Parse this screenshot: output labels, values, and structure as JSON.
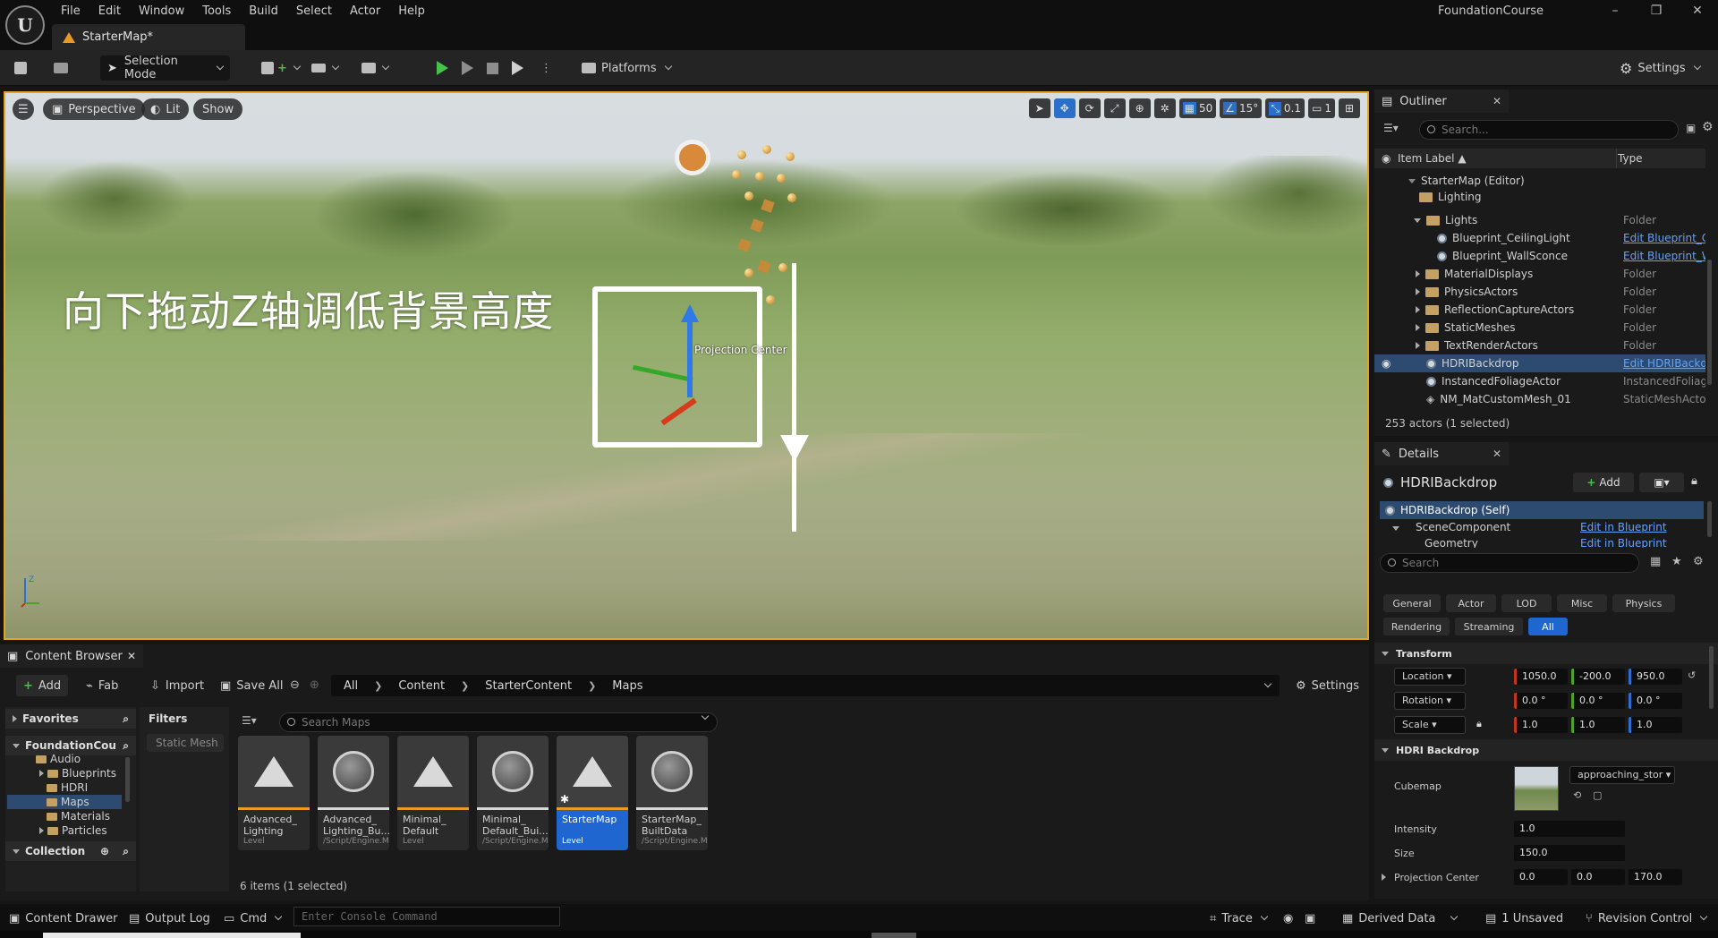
{
  "app": {
    "project_name": "FoundationCourse",
    "map_tab": "StarterMap*",
    "menus": [
      "File",
      "Edit",
      "Window",
      "Tools",
      "Build",
      "Select",
      "Actor",
      "Help"
    ]
  },
  "toolbar": {
    "selection_mode": "Selection Mode",
    "platforms": "Platforms",
    "settings": "Settings"
  },
  "viewport": {
    "perspective": "Perspective",
    "lit": "Lit",
    "show": "Show",
    "grid_snap": "50",
    "rot_snap": "15°",
    "scale_snap": "0.1",
    "camera_speed": "1",
    "annotation": "向下拖动Z轴调低背景高度",
    "actor_label": "Projection Center"
  },
  "outliner": {
    "title": "Outliner",
    "search_placeholder": "Search...",
    "col_label": "Item Label ▲",
    "col_type": "Type",
    "rows": [
      {
        "label": "StarterMap (Editor)",
        "type": ""
      },
      {
        "label": "Lighting",
        "type": ""
      },
      {
        "label": "Lights",
        "type": "Folder"
      },
      {
        "label": "Blueprint_CeilingLight",
        "type": "Edit Blueprint_C"
      },
      {
        "label": "Blueprint_WallSconce",
        "type": "Edit Blueprint_W"
      },
      {
        "label": "MaterialDisplays",
        "type": "Folder"
      },
      {
        "label": "PhysicsActors",
        "type": "Folder"
      },
      {
        "label": "ReflectionCaptureActors",
        "type": "Folder"
      },
      {
        "label": "StaticMeshes",
        "type": "Folder"
      },
      {
        "label": "TextRenderActors",
        "type": "Folder"
      },
      {
        "label": "HDRIBackdrop",
        "type": "Edit HDRIBackdr"
      },
      {
        "label": "InstancedFoliageActor",
        "type": "InstancedFoliag"
      },
      {
        "label": "NM_MatCustomMesh_01",
        "type": "StaticMeshActo"
      }
    ],
    "status": "253 actors (1 selected)"
  },
  "details": {
    "title": "Details",
    "actor_name": "HDRIBackdrop",
    "add": "Add",
    "self": "HDRIBackdrop (Self)",
    "scene_component": "SceneComponent",
    "geometry": "Geometry",
    "edit_in_bp": "Edit in Blueprint",
    "search_placeholder": "Search",
    "cat_tabs": [
      "General",
      "Actor",
      "LOD",
      "Misc",
      "Physics",
      "Rendering",
      "Streaming",
      "All"
    ],
    "transform": "Transform",
    "location": "Location",
    "rotation": "Rotation",
    "scale": "Scale",
    "loc": [
      "1050.0",
      "-200.0",
      "950.0"
    ],
    "rot": [
      "0.0 °",
      "0.0 °",
      "0.0 °"
    ],
    "scl": [
      "1.0",
      "1.0",
      "1.0"
    ],
    "hdri_section": "HDRI Backdrop",
    "cubemap_label": "Cubemap",
    "cubemap_value": "approaching_stor",
    "intensity_label": "Intensity",
    "intensity": "1.0",
    "size_label": "Size",
    "size": "150.0",
    "proj_center_label": "Projection Center",
    "proj_center": [
      "0.0",
      "0.0",
      "170.0"
    ]
  },
  "content_browser": {
    "title": "Content Browser",
    "add": "Add",
    "fab": "Fab",
    "import": "Import",
    "save_all": "Save All",
    "path": [
      "All",
      "Content",
      "StarterContent",
      "Maps"
    ],
    "settings": "Settings",
    "favorites": "Favorites",
    "project_root": "FoundationCou",
    "tree": [
      "Audio",
      "Blueprints",
      "HDRI",
      "Maps",
      "Materials",
      "Particles"
    ],
    "collection": "Collection",
    "filters": "Filters",
    "filter_chip": "Static Mesh",
    "search_placeholder": "Search Maps",
    "assets": [
      {
        "name": "Advanced_ Lighting",
        "sub": "Level"
      },
      {
        "name": "Advanced_ Lighting_Bu...",
        "sub": "/Script/Engine.M..."
      },
      {
        "name": "Minimal_ Default",
        "sub": "Level"
      },
      {
        "name": "Minimal_ Default_Bui...",
        "sub": "/Script/Engine.M..."
      },
      {
        "name": "StarterMap",
        "sub": "Level"
      },
      {
        "name": "StarterMap_ BuiltData",
        "sub": "/Script/Engine.M..."
      }
    ],
    "count": "6 items (1 selected)"
  },
  "statusbar": {
    "content_drawer": "Content Drawer",
    "output_log": "Output Log",
    "cmd": "Cmd",
    "console_placeholder": "Enter Console Command",
    "trace": "Trace",
    "derived_data": "Derived Data",
    "unsaved": "1 Unsaved",
    "revision_control": "Revision Control"
  }
}
